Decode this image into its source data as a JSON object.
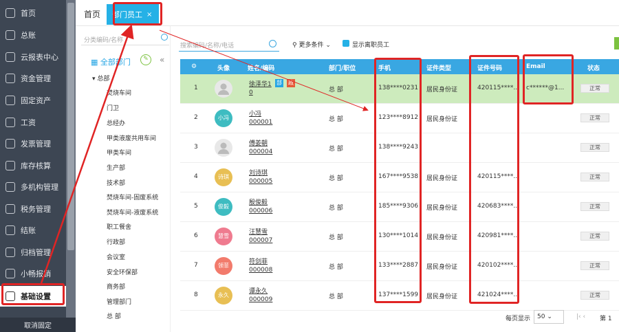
{
  "sidebar": {
    "items": [
      {
        "label": "首页",
        "icon": "home-icon"
      },
      {
        "label": "总账",
        "icon": "ledger-icon"
      },
      {
        "label": "云报表中心",
        "icon": "chart-icon"
      },
      {
        "label": "资金管理",
        "icon": "wallet-icon"
      },
      {
        "label": "固定资产",
        "icon": "building-icon"
      },
      {
        "label": "工资",
        "icon": "salary-icon"
      },
      {
        "label": "发票管理",
        "icon": "invoice-icon"
      },
      {
        "label": "库存核算",
        "icon": "inventory-icon"
      },
      {
        "label": "多机构管理",
        "icon": "org-icon"
      },
      {
        "label": "税务管理",
        "icon": "tax-icon"
      },
      {
        "label": "结账",
        "icon": "checkout-icon"
      },
      {
        "label": "归档管理",
        "icon": "archive-icon"
      },
      {
        "label": "小畅报销",
        "icon": "reimburse-icon"
      },
      {
        "label": "基础设置",
        "icon": "settings-icon"
      }
    ],
    "bottom_label": "取消固定"
  },
  "tabs": {
    "home": "首页",
    "active": "部门员工",
    "close": "×"
  },
  "tree": {
    "search_placeholder": "分类编码/名称",
    "all_label": "全部部门",
    "root": "总部",
    "children": [
      "焚烧车间",
      "门卫",
      "总经办",
      "甲类液废共用车间",
      "甲类车间",
      "生产部",
      "技术部",
      "焚烧车间-固废系统",
      "焚烧车间-液废系统",
      "职工餐舍",
      "行政部",
      "会议室",
      "安全环保部",
      "商务部",
      "管理部门",
      "总 部"
    ]
  },
  "toolbar": {
    "search_placeholder": "搜索编码/名称/电话",
    "more_filters": "更多条件",
    "show_resigned": "显示离职员工"
  },
  "table": {
    "headers": {
      "idx": "⚙",
      "avatar": "头像",
      "name": "姓名/编码",
      "dept": "部门/职位",
      "phone": "手机",
      "idtype": "证件类型",
      "idno": "证件号码",
      "email": "Email",
      "status": "状态"
    },
    "rows": [
      {
        "no": "1",
        "avatar": "",
        "name": "徐泽华1",
        "code": "0",
        "dept": "总 部",
        "phone": "138****0231",
        "idtype": "居民身份证",
        "idno": "420115****...",
        "email": "c******@1...",
        "status": "正常",
        "tags": [
          "部",
          "政"
        ]
      },
      {
        "no": "2",
        "avatar": "小冯",
        "name": "小冯",
        "code": "000001",
        "dept": "总 部",
        "phone": "123****8912",
        "idtype": "居民身份证",
        "idno": "",
        "email": "",
        "status": "正常"
      },
      {
        "no": "3",
        "avatar": "",
        "name": "傅姜朝",
        "code": "000004",
        "dept": "总 部",
        "phone": "138****9243",
        "idtype": "",
        "idno": "",
        "email": "",
        "status": "正常"
      },
      {
        "no": "4",
        "avatar": "诗琪",
        "name": "刘诗琪",
        "code": "000005",
        "dept": "总 部",
        "phone": "167****9538",
        "idtype": "居民身份证",
        "idno": "420115****...",
        "email": "",
        "status": "正常"
      },
      {
        "no": "5",
        "avatar": "俊毅",
        "name": "殷俊毅",
        "code": "000006",
        "dept": "总 部",
        "phone": "185****9306",
        "idtype": "居民身份证",
        "idno": "420683****...",
        "email": "",
        "status": "正常"
      },
      {
        "no": "6",
        "avatar": "慧雪",
        "name": "汪慧雪",
        "code": "000007",
        "dept": "总 部",
        "phone": "130****1014",
        "idtype": "居民身份证",
        "idno": "420981****...",
        "email": "",
        "status": "正常"
      },
      {
        "no": "7",
        "avatar": "领菲",
        "name": "符剑菲",
        "code": "000008",
        "dept": "总 部",
        "phone": "133****2887",
        "idtype": "居民身份证",
        "idno": "420102****...",
        "email": "",
        "status": "正常"
      },
      {
        "no": "8",
        "avatar": "永久",
        "name": "谭永久",
        "code": "000009",
        "dept": "总 部",
        "phone": "137****1599",
        "idtype": "居民身份证",
        "idno": "421024****...",
        "email": "",
        "status": "正常"
      }
    ]
  },
  "pager": {
    "per_page_label": "每页显示",
    "per_page": "50",
    "first": "|‹",
    "prev": "‹",
    "page_label": "第 1"
  },
  "colors": {
    "sidebar": "#3d4653",
    "accent": "#25b1e6",
    "header": "#39a7e2",
    "highlight": "#cdebbd",
    "annotation": "#e02424"
  }
}
